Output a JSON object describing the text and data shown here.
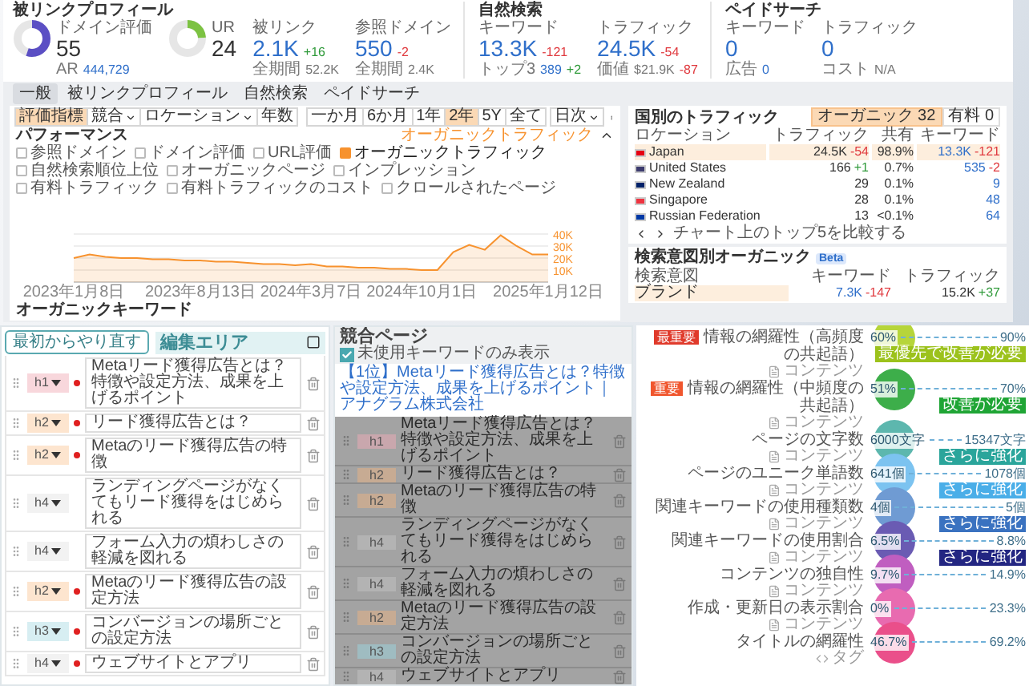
{
  "backlink_profile": {
    "title": "被リンクプロフィール",
    "metrics": [
      {
        "kind": "donut",
        "label": "ドメイン評価",
        "value": "55",
        "level": 0.55,
        "color": "#5b4fc4",
        "sub_label": "AR",
        "sub_value": "444,729",
        "sub_link": true
      },
      {
        "kind": "donut",
        "label": "UR",
        "value": "24",
        "level": 0.24,
        "color": "#7cc242"
      },
      {
        "kind": "stat",
        "label": "被リンク",
        "value": "2.1K",
        "delta": {
          "text": "+16",
          "color": "#2f9a3a"
        },
        "sub_label": "全期間",
        "sub_value": "52.2K",
        "sub_link": false
      },
      {
        "kind": "stat",
        "label": "参照ドメイン",
        "value": "550",
        "delta": {
          "text": "-2",
          "color": "#e0393e"
        },
        "sub_label": "全期間",
        "sub_value": "2.4K",
        "sub_link": false
      }
    ]
  },
  "organic_search": {
    "title": "自然検索",
    "metrics": [
      {
        "kind": "stat",
        "label": "キーワード",
        "value": "13.3K",
        "delta": {
          "text": "-121",
          "color": "#e0393e"
        },
        "sub_label": "トップ3",
        "sub_value": "389",
        "sub_link": true,
        "sub_delta": {
          "text": "+2",
          "color": "#2f9a3a"
        }
      },
      {
        "kind": "stat",
        "label": "トラフィック",
        "value": "24.5K",
        "delta": {
          "text": "-54",
          "color": "#e0393e"
        },
        "sub_label": "価値",
        "sub_value": "$21.9K",
        "sub_link": false,
        "sub_delta": {
          "text": "-87",
          "color": "#e0393e"
        }
      }
    ]
  },
  "paid_search": {
    "title": "ペイドサーチ",
    "metrics": [
      {
        "kind": "stat",
        "label": "キーワード",
        "value": "0",
        "sub_label": "広告",
        "sub_value": "0",
        "sub_link": true
      },
      {
        "kind": "stat",
        "label": "トラフィック",
        "value": "0",
        "sub_label": "コスト",
        "sub_value": "N/A",
        "sub_link": false
      }
    ]
  },
  "tabs": [
    {
      "label": "一般",
      "selected": true
    },
    {
      "label": "被リンクプロフィール",
      "selected": false
    },
    {
      "label": "自然検索",
      "selected": false
    },
    {
      "label": "ペイドサーチ",
      "selected": false
    }
  ],
  "toolbar": {
    "filters": [
      {
        "label": "評価指標",
        "selected": true,
        "dropdown": false
      },
      {
        "label": "競合",
        "selected": false,
        "dropdown": true
      },
      {
        "label": "ロケーション",
        "selected": false,
        "dropdown": true
      },
      {
        "label": "年数",
        "selected": false,
        "dropdown": false
      }
    ],
    "periods": [
      {
        "label": "一か月",
        "selected": false
      },
      {
        "label": "6か月",
        "selected": false
      },
      {
        "label": "1年",
        "selected": false
      },
      {
        "label": "2年",
        "selected": true
      },
      {
        "label": "5Y",
        "selected": false
      },
      {
        "label": "全て",
        "selected": false
      }
    ],
    "interval": {
      "label": "日次",
      "dropdown": true
    }
  },
  "performance": {
    "title": "パフォーマンス",
    "metrics": [
      {
        "label": "参照ドメイン",
        "checked": false
      },
      {
        "label": "ドメイン評価",
        "checked": false
      },
      {
        "label": "URL評価",
        "checked": false
      },
      {
        "label": "オーガニックトラフィック",
        "checked": true
      },
      {
        "label": "自然検索順位上位",
        "checked": false
      },
      {
        "label": "オーガニックページ",
        "checked": false
      },
      {
        "label": "インプレッション",
        "checked": false
      },
      {
        "label": "有料トラフィック",
        "checked": false
      },
      {
        "label": "有料トラフィックのコスト",
        "checked": false
      },
      {
        "label": "クロールされたページ",
        "checked": false
      }
    ],
    "chart_data": {
      "type": "area",
      "grid": true,
      "ylim": [
        0,
        40000
      ],
      "categories": [
        "2023年1月8日",
        null,
        null,
        null,
        null,
        null,
        null,
        null,
        "2023年8月13日",
        null,
        null,
        null,
        null,
        null,
        null,
        "2024年3月7日",
        null,
        null,
        null,
        null,
        null,
        null,
        "2024年10月1日",
        null,
        null,
        null,
        null,
        null,
        null,
        null,
        "2025年1月12日"
      ],
      "yticks": [
        {
          "value": 10000,
          "label": "10K"
        },
        {
          "value": 20000,
          "label": "20K"
        },
        {
          "value": 30000,
          "label": "30K"
        },
        {
          "value": 40000,
          "label": "40K"
        }
      ],
      "series": [
        {
          "name": "オーガニックトラフィック",
          "color": "#f7922e",
          "values": [
            20000,
            23000,
            21000,
            20000,
            20000,
            19000,
            19000,
            18000,
            18000,
            17000,
            17000,
            16000,
            15000,
            15000,
            14000,
            15000,
            13000,
            13000,
            12000,
            12000,
            11000,
            11000,
            10000,
            10000,
            25000,
            31000,
            27000,
            39000,
            30000,
            23000,
            23000
          ]
        }
      ]
    }
  },
  "organic_keywords": {
    "title": "オーガニックキーワード"
  },
  "country_traffic": {
    "title": "国別のトラフィック",
    "toggles": [
      {
        "label": "オーガニック",
        "count": "32",
        "selected": true
      },
      {
        "label": "有料",
        "count": "0",
        "selected": false
      }
    ],
    "columns": [
      "ロケーション",
      "トラフィック",
      "共有",
      "キーワード"
    ],
    "rows": [
      {
        "country": "Japan",
        "color": "#e60012",
        "traffic": "24.5K",
        "traffic_delta": {
          "text": "-54",
          "color": "#e0393e"
        },
        "share": "98.9%",
        "keywords": "13.3K",
        "keywords_delta": {
          "text": "-121",
          "color": "#e0393e"
        },
        "selected": true
      },
      {
        "country": "United States",
        "color": "#3c3b6e",
        "traffic": "166",
        "traffic_delta": {
          "text": "+1",
          "color": "#2f9a3a"
        },
        "share": "0.7%",
        "keywords": "535",
        "keywords_delta": {
          "text": "-2",
          "color": "#e0393e"
        },
        "selected": false
      },
      {
        "country": "New Zealand",
        "color": "#012169",
        "traffic": "29",
        "share": "0.1%",
        "keywords": "9",
        "selected": false
      },
      {
        "country": "Singapore",
        "color": "#ef3340",
        "traffic": "28",
        "share": "0.1%",
        "keywords": "48",
        "selected": false
      },
      {
        "country": "Russian Federation",
        "color": "#0039a6",
        "traffic": "13",
        "share": "<0.1%",
        "keywords": "64",
        "selected": false
      }
    ],
    "footer": "チャート上のトップ5を比較する"
  },
  "intent": {
    "title": "検索意図別オーガニック",
    "badge": "Beta",
    "columns": [
      "検索意図",
      "キーワード",
      "トラフィック"
    ],
    "rows": [
      {
        "intent": "ブランド",
        "keywords": "7.3K",
        "keywords_delta": {
          "text": "-147",
          "color": "#e0393e"
        },
        "traffic": "15.2K",
        "traffic_delta": {
          "text": "+37",
          "color": "#2f9a3a"
        },
        "selected": true
      }
    ]
  },
  "editor": {
    "restart_button": "最初からやり直す",
    "title": "編集エリア",
    "headings": [
      {
        "level": "h1",
        "color": "#f8d7dc",
        "required": true,
        "text": "Metaリード獲得広告とは？特徴や設定方法、成果を上げるポイント"
      },
      {
        "level": "h2",
        "color": "#fde5cf",
        "required": true,
        "text": "リード獲得広告とは？"
      },
      {
        "level": "h2",
        "color": "#fde5cf",
        "required": true,
        "text": "Metaのリード獲得広告の特徴"
      },
      {
        "level": "h4",
        "color": "#f2f2f2",
        "required": false,
        "text": "ランディングページがなくてもリード獲得をはじめられる"
      },
      {
        "level": "h4",
        "color": "#f2f2f2",
        "required": false,
        "text": "フォーム入力の煩わしさの軽減を図れる"
      },
      {
        "level": "h2",
        "color": "#fde5cf",
        "required": true,
        "text": "Metaのリード獲得広告の設定方法"
      },
      {
        "level": "h3",
        "color": "#d7eef2",
        "required": true,
        "text": "コンバージョンの場所ごとの設定方法"
      },
      {
        "level": "h4",
        "color": "#f2f2f2",
        "required": true,
        "text": "ウェブサイトとアプリ"
      }
    ]
  },
  "competitor": {
    "title": "競合ページ",
    "filter": {
      "label": "未使用キーワードのみ表示",
      "checked": true
    },
    "link": "【1位】Metaリード獲得広告とは？特徴や設定方法、成果を上げるポイント｜アナグラム株式会社",
    "headings": [
      {
        "level": "h1",
        "color": "#c9a7ad",
        "text": "Metaリード獲得広告とは？特徴や設定方法、成果を上げるポイント"
      },
      {
        "level": "h2",
        "color": "#c7ab93",
        "text": "リード獲得広告とは？"
      },
      {
        "level": "h2",
        "color": "#c7ab93",
        "text": "Metaのリード獲得広告の特徴"
      },
      {
        "level": "h4",
        "color": "#b3b3b3",
        "text": "ランディングページがなくてもリード獲得をはじめられる"
      },
      {
        "level": "h4",
        "color": "#b3b3b3",
        "text": "フォーム入力の煩わしさの軽減を図れる"
      },
      {
        "level": "h2",
        "color": "#c7ab93",
        "text": "Metaのリード獲得広告の設定方法"
      },
      {
        "level": "h3",
        "color": "#9fbcc1",
        "text": "コンバージョンの場所ごとの設定方法"
      },
      {
        "level": "h4",
        "color": "#b3b3b3",
        "text": "ウェブサイトとアプリ"
      }
    ]
  },
  "comparison": {
    "rows": [
      {
        "label": "情報の網羅性（高頻度の共起語）",
        "badge": {
          "text": "最重要",
          "color": "#e03a2b"
        },
        "category": "コンテンツ",
        "kind": "content",
        "current": "60%",
        "target": "90%",
        "color": "#b6d53a",
        "callout": {
          "text": "最優先で改善が必要",
          "color": "#9cc21c"
        }
      },
      {
        "label": "情報の網羅性（中頻度の共起語）",
        "badge": {
          "text": "重要",
          "color": "#f0562e"
        },
        "category": "コンテンツ",
        "kind": "content",
        "current": "51%",
        "target": "70%",
        "color": "#3dae4a",
        "callout": {
          "text": "改善が必要",
          "color": "#1fa535"
        }
      },
      {
        "label": "ページの文字数",
        "category": "コンテンツ",
        "kind": "content",
        "current": "6000文字",
        "target": "15347文字",
        "color": "#5db7ae",
        "callout": {
          "text": "さらに強化",
          "color": "#2aa59b"
        }
      },
      {
        "label": "ページのユニーク単語数",
        "category": "コンテンツ",
        "kind": "content",
        "current": "641個",
        "target": "1078個",
        "color": "#7cc3f0",
        "callout": {
          "text": "さらに強化",
          "color": "#4aaee8"
        }
      },
      {
        "label": "関連キーワードの使用種類数",
        "category": "コンテンツ",
        "kind": "content",
        "current": "4個",
        "target": "5個",
        "color": "#6f9bd3",
        "callout": {
          "text": "さらに強化",
          "color": "#3a72c0"
        }
      },
      {
        "label": "関連キーワードの使用割合",
        "category": "コンテンツ",
        "kind": "content",
        "current": "6.5%",
        "target": "8.8%",
        "color": "#6a5bb3",
        "callout": {
          "text": "さらに強化",
          "color": "#232682"
        }
      },
      {
        "label": "コンテンツの独自性",
        "category": "コンテンツ",
        "kind": "content",
        "current": "9.7%",
        "target": "14.9%",
        "color": "#c05ec0"
      },
      {
        "label": "作成・更新日の表示割合",
        "category": "コンテンツ",
        "kind": "content",
        "current": "0%",
        "target": "23.3%",
        "color": "#e86bb0"
      },
      {
        "label": "タイトルの網羅性",
        "category": "タグ",
        "kind": "tag",
        "current": "46.7%",
        "target": "69.2%",
        "color": "#ea4f8a"
      }
    ]
  }
}
